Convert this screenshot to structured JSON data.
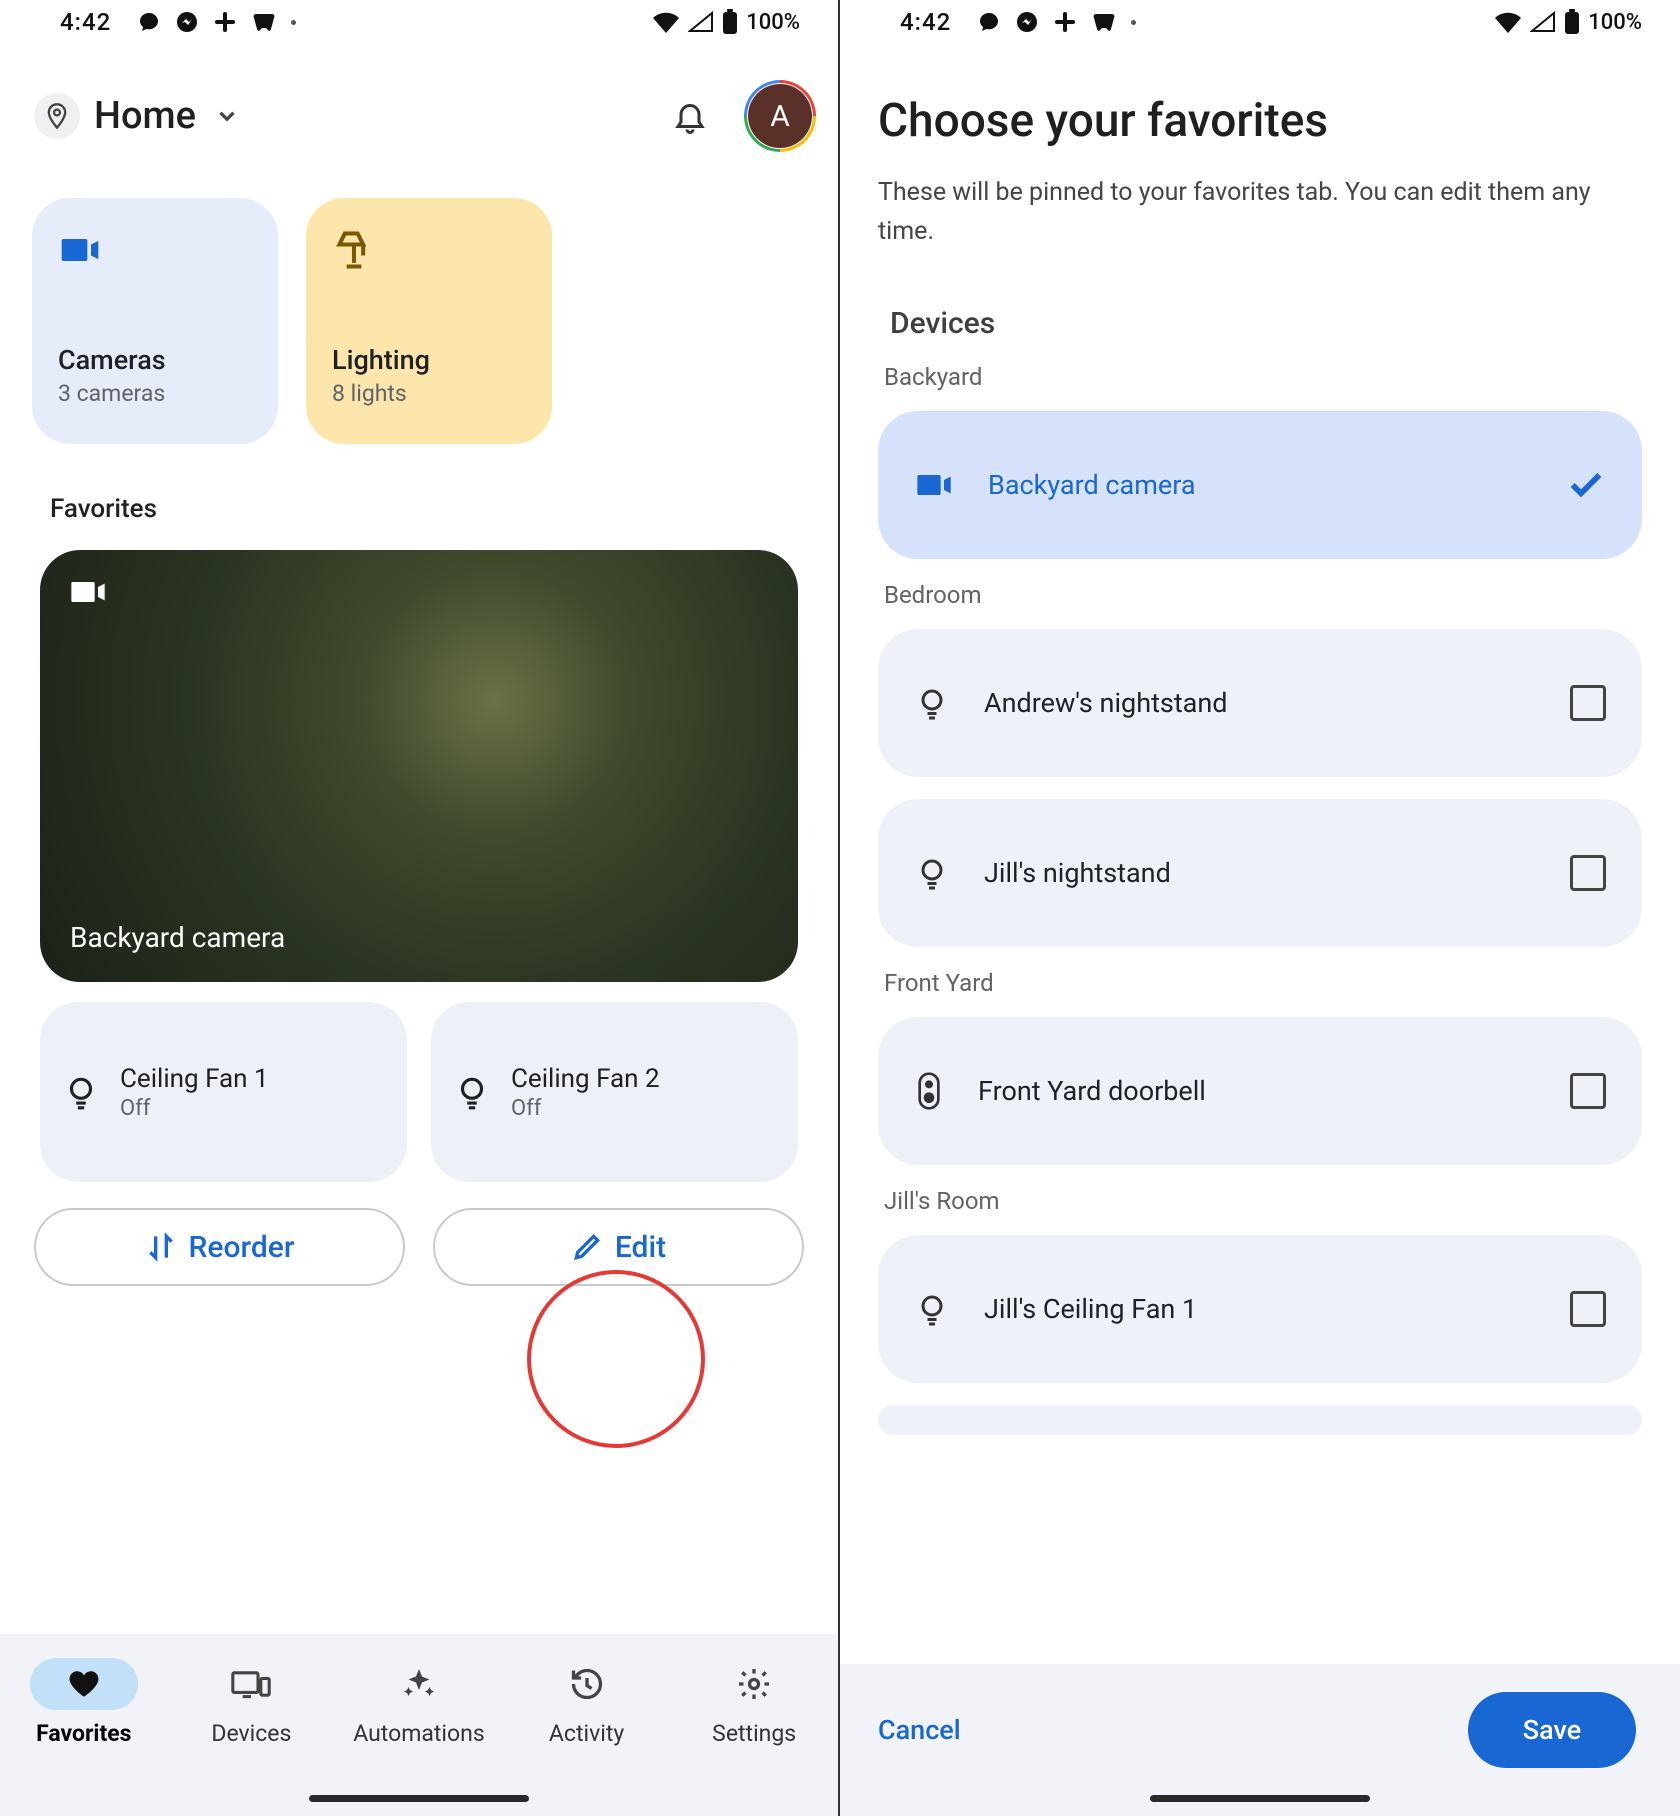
{
  "statusbar": {
    "time": "4:42",
    "battery": "100%"
  },
  "left": {
    "home_name": "Home",
    "avatar_letter": "A",
    "categories": [
      {
        "title": "Cameras",
        "subtitle": "3 cameras"
      },
      {
        "title": "Lighting",
        "subtitle": "8 lights"
      }
    ],
    "favorites_label": "Favorites",
    "camera_tile": "Backyard camera",
    "tiles": [
      {
        "title": "Ceiling Fan 1",
        "subtitle": "Off"
      },
      {
        "title": "Ceiling Fan 2",
        "subtitle": "Off"
      }
    ],
    "actions": {
      "reorder": "Reorder",
      "edit": "Edit"
    },
    "nav": {
      "favorites": "Favorites",
      "devices": "Devices",
      "automations": "Automations",
      "activity": "Activity",
      "settings": "Settings"
    }
  },
  "right": {
    "title": "Choose your favorites",
    "subtitle": "These will be pinned to your favorites tab. You can edit them any time.",
    "devices_label": "Devices",
    "rooms": [
      {
        "name": "Backyard",
        "items": [
          {
            "name": "Backyard camera",
            "type": "camera",
            "selected": true
          }
        ]
      },
      {
        "name": "Bedroom",
        "items": [
          {
            "name": "Andrew's nightstand",
            "type": "light",
            "selected": false
          },
          {
            "name": "Jill's nightstand",
            "type": "light",
            "selected": false
          }
        ]
      },
      {
        "name": "Front Yard",
        "items": [
          {
            "name": "Front Yard doorbell",
            "type": "doorbell",
            "selected": false
          }
        ]
      },
      {
        "name": "Jill's Room",
        "items": [
          {
            "name": "Jill's Ceiling Fan 1",
            "type": "light",
            "selected": false
          }
        ]
      }
    ],
    "cancel": "Cancel",
    "save": "Save"
  }
}
